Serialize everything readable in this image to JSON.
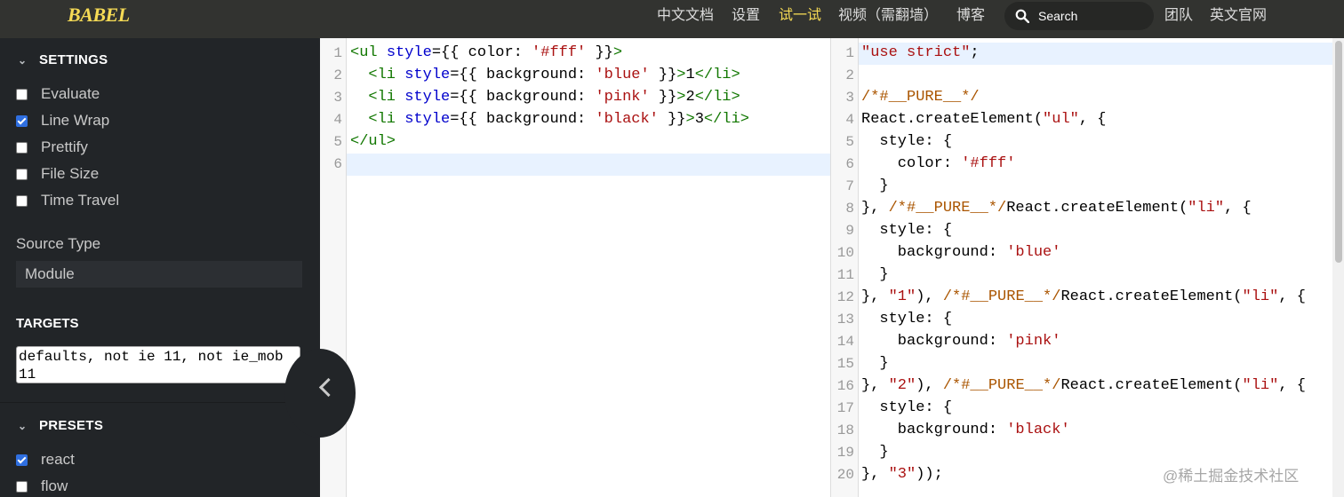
{
  "topnav": {
    "logo": "BABEL",
    "links": [
      "中文文档",
      "设置",
      "试一试",
      "视频（需翻墙）",
      "博客"
    ],
    "search_label": "Search",
    "right_links": [
      "团队",
      "英文官网"
    ]
  },
  "sidebar": {
    "settings_title": "SETTINGS",
    "options": [
      {
        "label": "Evaluate",
        "checked": false
      },
      {
        "label": "Line Wrap",
        "checked": true
      },
      {
        "label": "Prettify",
        "checked": false
      },
      {
        "label": "File Size",
        "checked": false
      },
      {
        "label": "Time Travel",
        "checked": false
      }
    ],
    "source_type_label": "Source Type",
    "source_type_value": "Module",
    "targets_title": "TARGETS",
    "targets_value": "defaults, not ie 11, not ie_mob 11",
    "presets_title": "PRESETS",
    "presets": [
      {
        "label": "react",
        "checked": true
      },
      {
        "label": "flow",
        "checked": false
      }
    ]
  },
  "input_editor": {
    "line_numbers": [
      "1",
      "2",
      "3",
      "4",
      "5",
      "6"
    ]
  },
  "output_editor": {
    "line_numbers": [
      "1",
      "2",
      "3",
      "4",
      "5",
      "6",
      "7",
      "8",
      "9",
      "10",
      "11",
      "12",
      "13",
      "14",
      "15",
      "16",
      "17",
      "18",
      "19",
      "20"
    ]
  },
  "watermark": "@稀土掘金技术社区"
}
